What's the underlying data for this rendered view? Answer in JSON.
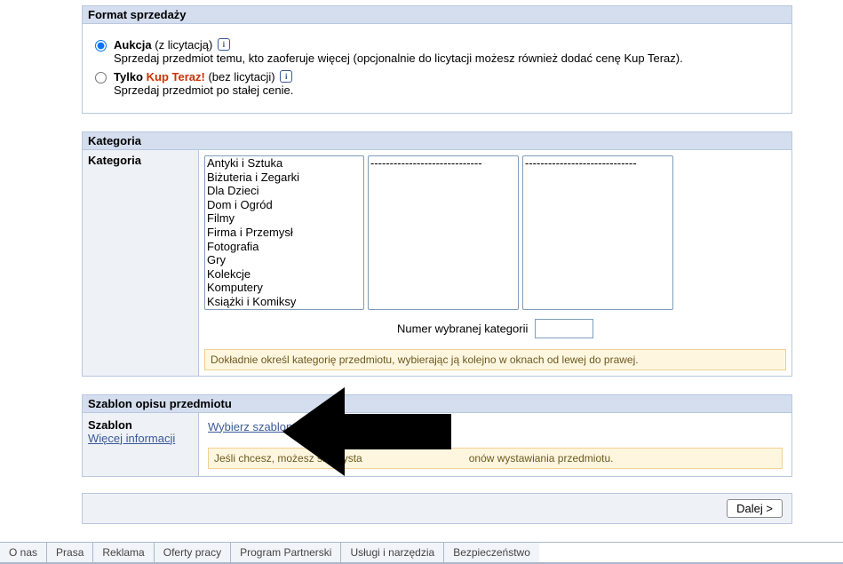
{
  "format": {
    "heading": "Format sprzedaży",
    "auction": {
      "label": "Aukcja",
      "parens": "(z licytacją)",
      "desc": "Sprzedaj przedmiot temu, kto zaoferuje więcej (opcjonalnie do licytacji możesz również dodać cenę Kup Teraz)."
    },
    "buynow": {
      "label": "Tylko ",
      "kupteraz": "Kup Teraz!",
      "parens": "(bez licytacji)",
      "desc": "Sprzedaj przedmiot po stałej cenie."
    }
  },
  "category": {
    "heading": "Kategoria",
    "label": "Kategoria",
    "options1": [
      "Antyki i Sztuka",
      "Biżuteria i Zegarki",
      "Dla Dzieci",
      "Dom i Ogród",
      "Filmy",
      "Firma i Przemysł",
      "Fotografia",
      "Gry",
      "Kolekcje",
      "Komputery",
      "Książki i Komiksy"
    ],
    "placeholder2": "-----------------------------",
    "placeholder3": "-----------------------------",
    "number_label": "Numer wybranej kategorii",
    "number_value": "",
    "hint": "Dokładnie określ kategorię przedmiotu, wybierając ją kolejno w oknach od lewej do prawej."
  },
  "template": {
    "heading": "Szablon opisu przedmiotu",
    "label": "Szablon",
    "more_link": "Więcej informacji",
    "choose_link": "Wybierz szablon >",
    "hint_pre": "Jeśli chcesz, możesz skorzysta",
    "hint_post": "onów wystawiania przedmiotu."
  },
  "next_button": "Dalej >",
  "footer": {
    "tabs": [
      "O nas",
      "Prasa",
      "Reklama",
      "Oferty pracy",
      "Program Partnerski",
      "Usługi i narzędzia",
      "Bezpieczeństwo"
    ]
  }
}
